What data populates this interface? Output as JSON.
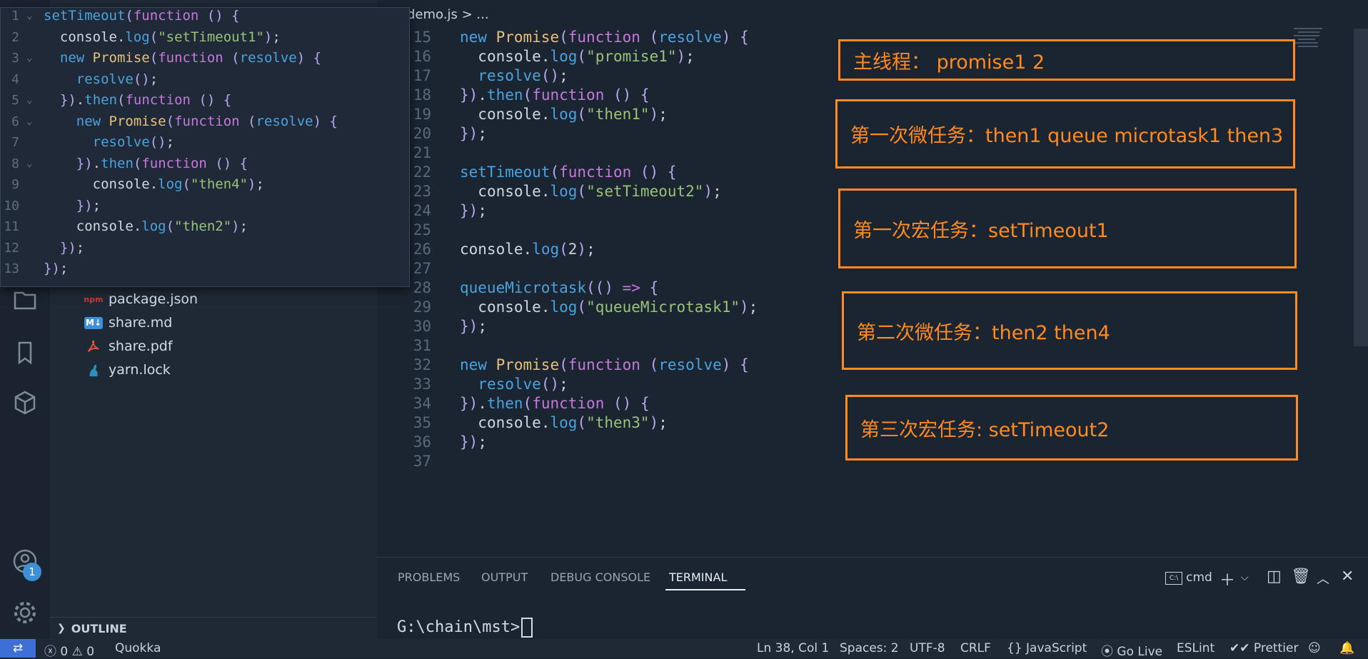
{
  "breadcrumb": {
    "file": "demo.js",
    "sep": ">",
    "rest": "..."
  },
  "sidebar": {
    "files": [
      {
        "name": "package.json",
        "icon": "npm"
      },
      {
        "name": "share.md",
        "icon": "M↓"
      },
      {
        "name": "share.pdf",
        "icon": "pdf"
      },
      {
        "name": "yarn.lock",
        "icon": "yarn"
      }
    ],
    "outline_label": "OUTLINE",
    "badge": "1"
  },
  "peek": {
    "lines": [
      {
        "n": "1",
        "t": "setTimeout(function () {"
      },
      {
        "n": "2",
        "t": "  console.log(\"setTimeout1\");"
      },
      {
        "n": "3",
        "t": "  new Promise(function (resolve) {"
      },
      {
        "n": "4",
        "t": "    resolve();"
      },
      {
        "n": "5",
        "t": "  }).then(function () {"
      },
      {
        "n": "6",
        "t": "    new Promise(function (resolve) {"
      },
      {
        "n": "7",
        "t": "      resolve();"
      },
      {
        "n": "8",
        "t": "    }).then(function () {"
      },
      {
        "n": "9",
        "t": "      console.log(\"then4\");"
      },
      {
        "n": "10",
        "t": "    });"
      },
      {
        "n": "11",
        "t": "    console.log(\"then2\");"
      },
      {
        "n": "12",
        "t": "  });"
      },
      {
        "n": "13",
        "t": "});"
      }
    ]
  },
  "editor": {
    "lines": [
      {
        "n": "15",
        "t": "new Promise(function (resolve) {"
      },
      {
        "n": "16",
        "t": "  console.log(\"promise1\");"
      },
      {
        "n": "17",
        "t": "  resolve();"
      },
      {
        "n": "18",
        "t": "}).then(function () {"
      },
      {
        "n": "19",
        "t": "  console.log(\"then1\");"
      },
      {
        "n": "20",
        "t": "});"
      },
      {
        "n": "21",
        "t": ""
      },
      {
        "n": "22",
        "t": "setTimeout(function () {"
      },
      {
        "n": "23",
        "t": "  console.log(\"setTimeout2\");"
      },
      {
        "n": "24",
        "t": "});"
      },
      {
        "n": "25",
        "t": ""
      },
      {
        "n": "26",
        "t": "console.log(2);"
      },
      {
        "n": "27",
        "t": ""
      },
      {
        "n": "28",
        "t": "queueMicrotask(() => {"
      },
      {
        "n": "29",
        "t": "  console.log(\"queueMicrotask1\");"
      },
      {
        "n": "30",
        "t": "});"
      },
      {
        "n": "31",
        "t": ""
      },
      {
        "n": "32",
        "t": "new Promise(function (resolve) {"
      },
      {
        "n": "33",
        "t": "  resolve();"
      },
      {
        "n": "34",
        "t": "}).then(function () {"
      },
      {
        "n": "35",
        "t": "  console.log(\"then3\");"
      },
      {
        "n": "36",
        "t": "});"
      },
      {
        "n": "37",
        "t": ""
      }
    ]
  },
  "notes": {
    "main": "主线程： promise1 2",
    "micro1": "第一次微任务：then1 queue microtask1 then3",
    "macro1": "第一次宏任务：setTimeout1",
    "micro2": "第二次微任务：then2 then4",
    "macro3": "第三次宏任务: setTimeout2"
  },
  "panel": {
    "tabs": [
      "PROBLEMS",
      "OUTPUT",
      "DEBUG CONSOLE",
      "TERMINAL"
    ],
    "active_tab": "TERMINAL",
    "shell": "cmd",
    "prompt": "G:\\chain\\mst>"
  },
  "status": {
    "errors": "0",
    "warnings": "0",
    "quokka": "Quokka",
    "position": "Ln 38, Col 1",
    "spaces": "Spaces: 2",
    "encoding": "UTF-8",
    "eol": "CRLF",
    "language": "JavaScript",
    "golive": "Go Live",
    "eslint": "ESLint",
    "prettier": "Prettier"
  },
  "colors": {
    "annotation": "#ff8a1f",
    "accent": "#3d8fd6",
    "background": "#1b2431"
  }
}
